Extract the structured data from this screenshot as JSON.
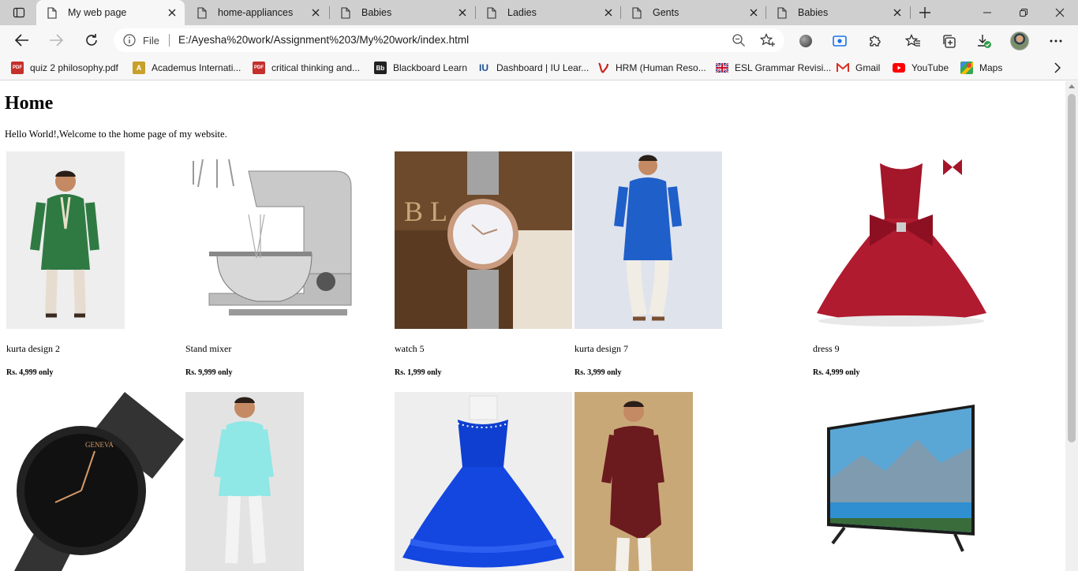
{
  "tabs": [
    {
      "title": "My web page",
      "active": true
    },
    {
      "title": "home-appliances",
      "active": false
    },
    {
      "title": "Babies",
      "active": false
    },
    {
      "title": "Ladies",
      "active": false
    },
    {
      "title": "Gents",
      "active": false
    },
    {
      "title": "Babies",
      "active": false
    }
  ],
  "omnibox": {
    "scheme_label": "File",
    "url": "E:/Ayesha%20work/Assignment%203/My%20work/index.html"
  },
  "bookmarks": [
    {
      "label": "quiz 2 philosophy.pdf",
      "icon": "pdf-icon",
      "badge": "PDF",
      "color": "#c5302c"
    },
    {
      "label": "Academus Internati...",
      "icon": "academus-icon",
      "badge": "A",
      "color": "#c8a02a"
    },
    {
      "label": "critical thinking and...",
      "icon": "pdf-icon",
      "badge": "PDF",
      "color": "#c5302c"
    },
    {
      "label": "Blackboard Learn",
      "icon": "blackboard-icon",
      "badge": "Bb",
      "color": "#222222"
    },
    {
      "label": "Dashboard | IU Lear...",
      "icon": "iu-icon",
      "badge": "IU",
      "color": "#1d4f91"
    },
    {
      "label": "HRM (Human Reso...",
      "icon": "hrm-icon",
      "badge": "",
      "color": "#cc2222"
    },
    {
      "label": "ESL Grammar Revisi...",
      "icon": "uk-flag-icon",
      "badge": "",
      "color": "#1f3c88"
    },
    {
      "label": "Gmail",
      "icon": "gmail-icon",
      "badge": "M",
      "color": "#d93025"
    },
    {
      "label": "YouTube",
      "icon": "youtube-icon",
      "badge": "▶",
      "color": "#ff0000"
    },
    {
      "label": "Maps",
      "icon": "maps-icon",
      "badge": "",
      "color": "#34a853"
    }
  ],
  "page": {
    "heading": "Home",
    "intro": "Hello World!,Welcome to the home page of my website."
  },
  "products": [
    {
      "name": "kurta design 2",
      "price": "Rs. 4,999 only",
      "image": "green-kurta-photo"
    },
    {
      "name": "Stand mixer",
      "price": "Rs. 9,999 only",
      "image": "stand-mixer-photo"
    },
    {
      "name": "watch 5",
      "price": "Rs. 1,999 only",
      "image": "ladies-watch-photo"
    },
    {
      "name": "kurta design 7",
      "price": "Rs. 3,999 only",
      "image": "blue-kurta-photo"
    },
    {
      "name": "dress 9",
      "price": "Rs. 4,999 only",
      "image": "red-dress-photo"
    },
    {
      "name": "",
      "price": "",
      "image": "black-watch-photo"
    },
    {
      "name": "",
      "price": "",
      "image": "aqua-kurta-photo"
    },
    {
      "name": "",
      "price": "",
      "image": "blue-dress-photo"
    },
    {
      "name": "",
      "price": "",
      "image": "maroon-kurta-photo"
    },
    {
      "name": "",
      "price": "",
      "image": "led-tv-photo"
    }
  ]
}
